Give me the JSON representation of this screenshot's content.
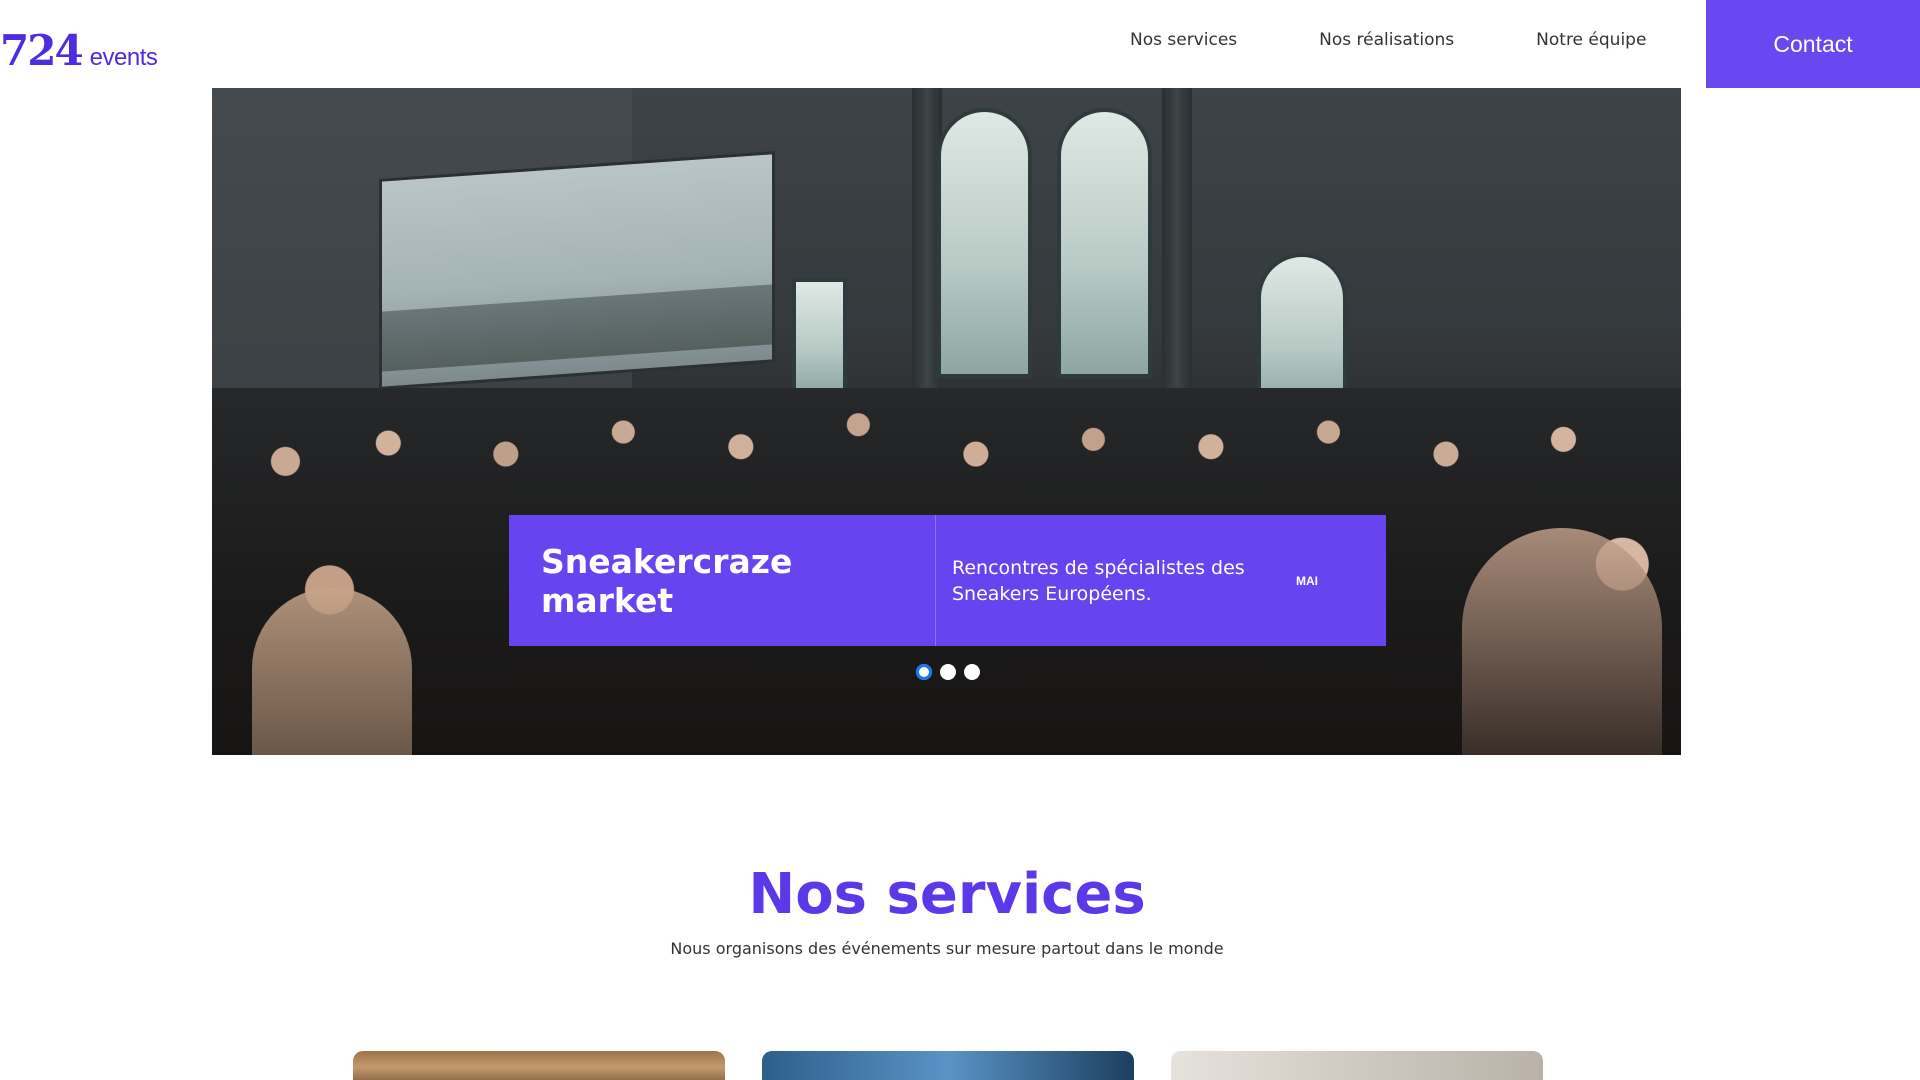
{
  "header": {
    "logo_number": "724",
    "logo_word": "events",
    "nav": [
      "Nos services",
      "Nos réalisations",
      "Notre équipe"
    ],
    "contact_label": "Contact"
  },
  "hero": {
    "card": {
      "title": "Sneakercraze market",
      "description": "Rencontres de spécialistes des Sneakers Européens.",
      "month": "MAI"
    },
    "slides_total": 3,
    "active_slide": 1
  },
  "services": {
    "title": "Nos services",
    "subtitle": "Nous organisons des événements sur mesure partout dans le monde"
  },
  "colors": {
    "accent": "#6843f0",
    "title": "#5b38e8",
    "dot_active": "#1976f0"
  }
}
